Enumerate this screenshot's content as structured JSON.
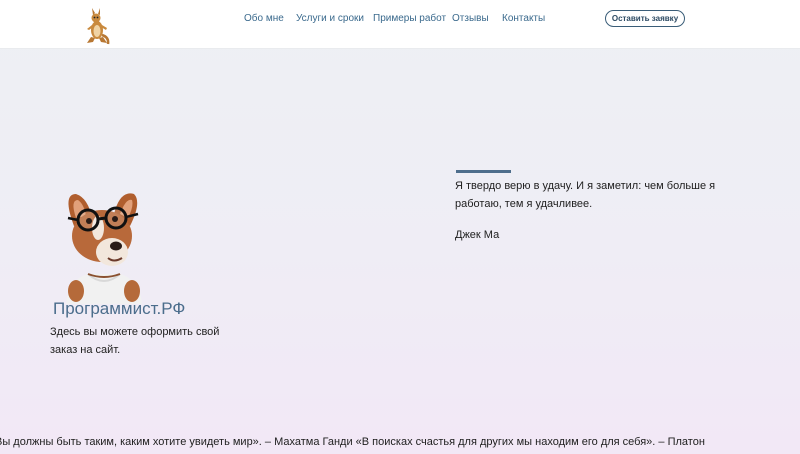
{
  "header": {
    "logo_icon": "kangaroo-logo-icon",
    "nav": [
      {
        "id": "about",
        "label": "Обо мне"
      },
      {
        "id": "services",
        "label": "Услуги и сроки"
      },
      {
        "id": "portfolio",
        "label": "Примеры работ"
      },
      {
        "id": "reviews",
        "label": "Отзывы"
      },
      {
        "id": "contacts",
        "label": "Контакты"
      }
    ],
    "cta_label": "Оставить заявку"
  },
  "hero": {
    "mascot_icon": "dog-with-glasses-mascot",
    "brand": "Программист.РФ",
    "tagline": "Здесь вы можете оформить свой заказ на сайт."
  },
  "quote": {
    "text": "Я твердо верю в удачу. И я заметил: чем больше я работаю, тем я удачливее.",
    "author": "Джек Ма"
  },
  "ticker": {
    "text": "Вы должны быть таким, каким хотите увидеть мир». – Махатма Ганди «В поисках счастья для других мы находим его для себя». – Платон"
  },
  "colors": {
    "accent": "#3b6a8d",
    "brand_text": "#4b6d8c",
    "quote_bar": "#4e6e8c"
  }
}
